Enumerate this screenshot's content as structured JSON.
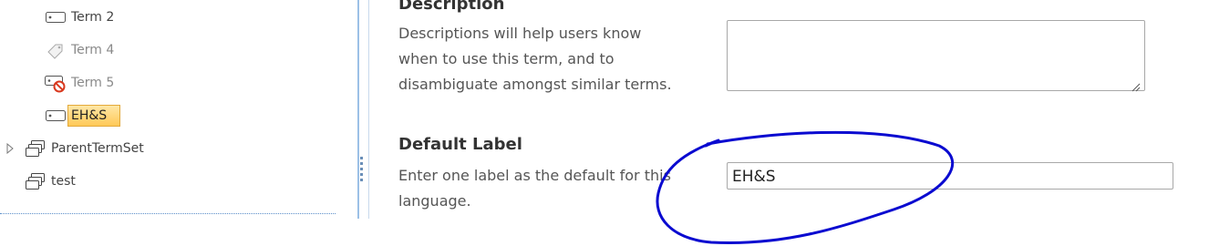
{
  "tree": {
    "items": [
      {
        "label": "Term 2",
        "icon": "term-tag-icon",
        "state": "normal"
      },
      {
        "label": "Term 4",
        "icon": "deprecated-tag-icon",
        "state": "dim"
      },
      {
        "label": "Term 5",
        "icon": "blocked-tag-icon",
        "state": "dim"
      },
      {
        "label": "EH&S",
        "icon": "term-tag-icon",
        "state": "selected"
      },
      {
        "label": "ParentTermSet",
        "icon": "term-set-icon",
        "state": "collapsed"
      },
      {
        "label": "test",
        "icon": "term-set-icon",
        "state": "normal"
      }
    ]
  },
  "description": {
    "title": "Description",
    "help_lines": [
      "Descriptions will help users know",
      "when to use this term, and to",
      "disambiguate amongst similar terms."
    ],
    "value": ""
  },
  "default_label": {
    "title": "Default Label",
    "help_lines": [
      "Enter one label as the default for this",
      "language."
    ],
    "value": "EH&S"
  },
  "colors": {
    "annotation": "#0a0ad0",
    "selection": "#ffc957"
  }
}
